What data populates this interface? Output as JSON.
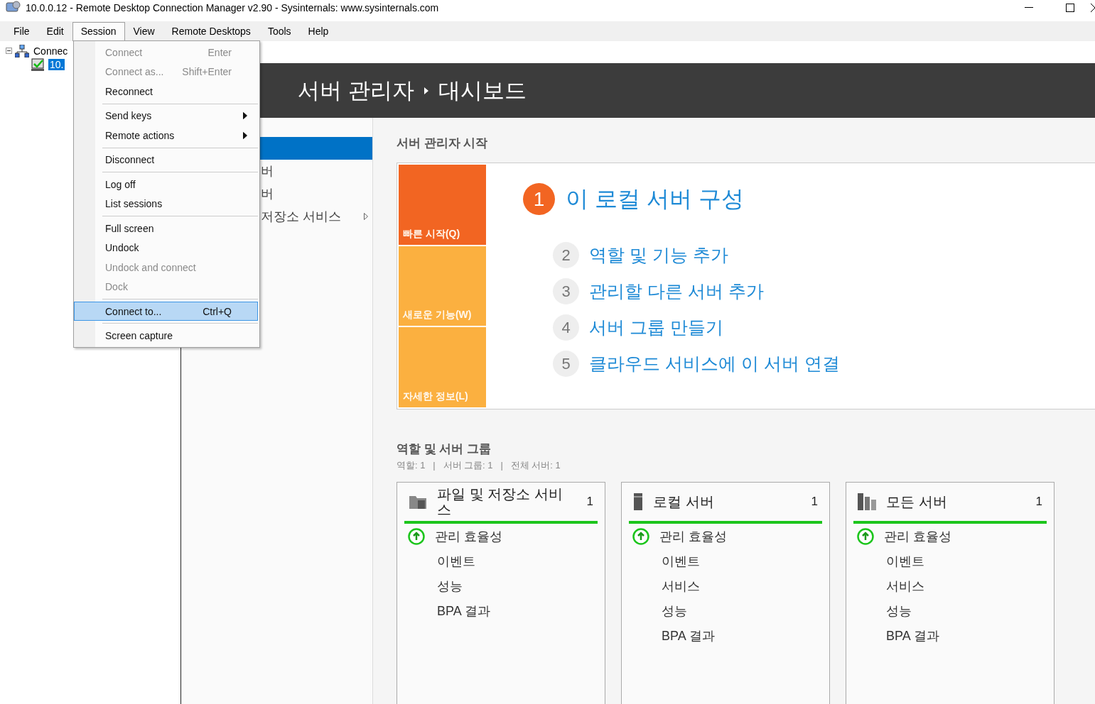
{
  "window": {
    "title": "10.0.0.12 - Remote Desktop Connection Manager v2.90 - Sysinternals: www.sysinternals.com"
  },
  "menu_bar": [
    {
      "label": "File",
      "selected": false
    },
    {
      "label": "Edit",
      "selected": false
    },
    {
      "label": "Session",
      "selected": true
    },
    {
      "label": "View",
      "selected": false
    },
    {
      "label": "Remote Desktops",
      "selected": false
    },
    {
      "label": "Tools",
      "selected": false
    },
    {
      "label": "Help",
      "selected": false
    }
  ],
  "tree": [
    {
      "label": "Connec",
      "expanded": true,
      "kind": "group",
      "selected": false,
      "children": [
        {
          "label": "10.",
          "kind": "server",
          "selected": true
        }
      ]
    }
  ],
  "session_menu": [
    {
      "kind": "item",
      "label": "Connect",
      "shortcut": "Enter",
      "disabled": true,
      "submenu": false,
      "selected": false
    },
    {
      "kind": "item",
      "label": "Connect as...",
      "shortcut": "Shift+Enter",
      "disabled": true,
      "submenu": false,
      "selected": false
    },
    {
      "kind": "item",
      "label": "Reconnect",
      "disabled": false,
      "submenu": false,
      "selected": false
    },
    {
      "kind": "separator"
    },
    {
      "kind": "item",
      "label": "Send keys",
      "disabled": false,
      "submenu": true,
      "selected": false
    },
    {
      "kind": "item",
      "label": "Remote actions",
      "disabled": false,
      "submenu": true,
      "selected": false
    },
    {
      "kind": "separator"
    },
    {
      "kind": "item",
      "label": "Disconnect",
      "disabled": false,
      "submenu": false,
      "selected": false
    },
    {
      "kind": "separator"
    },
    {
      "kind": "item",
      "label": "Log off",
      "disabled": false,
      "submenu": false,
      "selected": false
    },
    {
      "kind": "item",
      "label": "List sessions",
      "disabled": false,
      "submenu": false,
      "selected": false
    },
    {
      "kind": "separator"
    },
    {
      "kind": "item",
      "label": "Full screen",
      "disabled": false,
      "submenu": false,
      "selected": false
    },
    {
      "kind": "item",
      "label": "Undock",
      "disabled": false,
      "submenu": false,
      "selected": false
    },
    {
      "kind": "item",
      "label": "Undock and connect",
      "disabled": true,
      "submenu": false,
      "selected": false
    },
    {
      "kind": "item",
      "label": "Dock",
      "disabled": true,
      "submenu": false,
      "selected": false
    },
    {
      "kind": "separator"
    },
    {
      "kind": "item",
      "label": "Connect to...",
      "shortcut": "Ctrl+Q",
      "disabled": false,
      "submenu": false,
      "selected": true
    },
    {
      "kind": "separator"
    },
    {
      "kind": "item",
      "label": "Screen capture",
      "disabled": false,
      "submenu": false,
      "selected": false
    }
  ],
  "remote": {
    "header": {
      "breadcrumb": [
        "서버 관리자",
        "대시보드"
      ]
    },
    "nav": [
      {
        "selected": true
      },
      {
        "label": "버",
        "selected": false,
        "submenu": false
      },
      {
        "label": "버",
        "selected": false,
        "submenu": false
      },
      {
        "label": "저장소 서비스",
        "selected": false,
        "submenu": true
      }
    ],
    "welcome": {
      "title": "서버 관리자 시작",
      "tiles": [
        {
          "label": "빠른 시작(Q)",
          "color": "#f26522"
        },
        {
          "label": "새로운 기능(W)",
          "color": "#fbb040"
        },
        {
          "label": "자세한 정보(L)",
          "color": "#fbb040"
        }
      ],
      "steps": [
        {
          "number": "1",
          "label": "이 로컬 서버 구성",
          "current": true
        },
        {
          "number": "2",
          "label": "역할 및 기능 추가",
          "current": false
        },
        {
          "number": "3",
          "label": "관리할 다른 서버 추가",
          "current": false
        },
        {
          "number": "4",
          "label": "서버 그룹 만들기",
          "current": false
        },
        {
          "number": "5",
          "label": "클라우드 서비스에 이 서버 연결",
          "current": false
        }
      ]
    },
    "groups": {
      "title": "역할 및 서버 그룹",
      "summary": "역할: 1   |   서버 그룹: 1   |   전체 서버: 1",
      "cards": [
        {
          "kind": "files",
          "title": "파일 및 저장소 서비스",
          "count": "1",
          "rows": [
            {
              "label": "관리 효율성",
              "kind": "status"
            },
            {
              "label": "이벤트",
              "kind": "plain"
            },
            {
              "label": "성능",
              "kind": "plain"
            },
            {
              "label": "BPA 결과",
              "kind": "plain"
            }
          ]
        },
        {
          "kind": "local",
          "title": "로컬 서버",
          "count": "1",
          "rows": [
            {
              "label": "관리 효율성",
              "kind": "status"
            },
            {
              "label": "이벤트",
              "kind": "plain"
            },
            {
              "label": "서비스",
              "kind": "plain"
            },
            {
              "label": "성능",
              "kind": "plain"
            },
            {
              "label": "BPA 결과",
              "kind": "plain"
            }
          ]
        },
        {
          "kind": "all",
          "title": "모든 서버",
          "count": "1",
          "rows": [
            {
              "label": "관리 효율성",
              "kind": "status"
            },
            {
              "label": "이벤트",
              "kind": "plain"
            },
            {
              "label": "서비스",
              "kind": "plain"
            },
            {
              "label": "성능",
              "kind": "plain"
            },
            {
              "label": "BPA 결과",
              "kind": "plain"
            }
          ]
        }
      ]
    }
  }
}
